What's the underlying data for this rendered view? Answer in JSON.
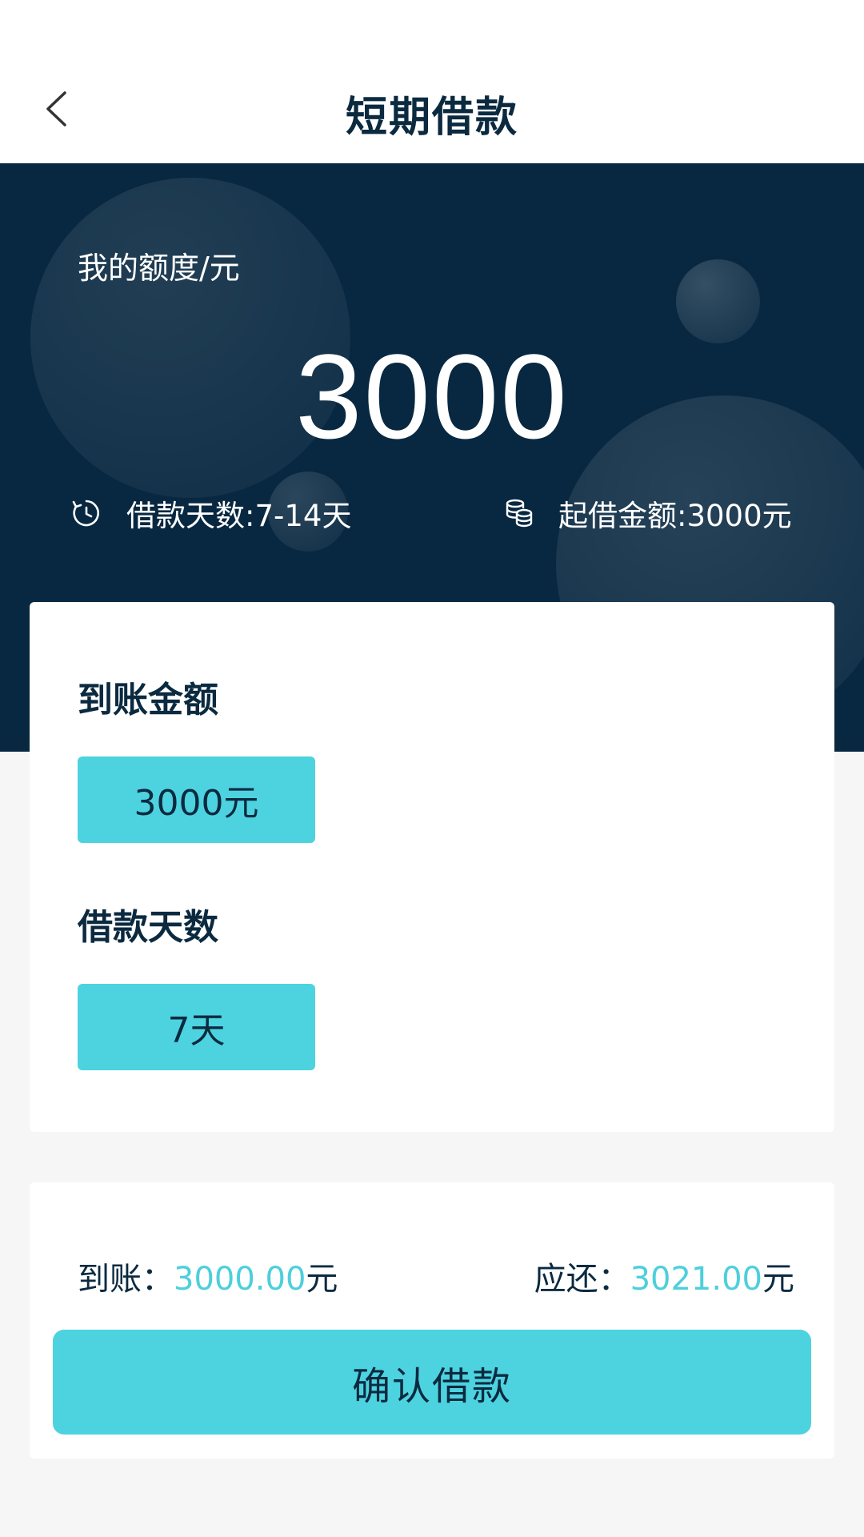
{
  "header": {
    "title": "短期借款",
    "back_icon": "chevron-left-icon"
  },
  "hero": {
    "quota_label": "我的额度/元",
    "quota_amount": "3000",
    "loan_days_text": "借款天数:7-14天",
    "min_amount_text": "起借金额:3000元",
    "loan_days_icon": "clock-refresh-icon",
    "min_amount_icon": "coin-stack-icon"
  },
  "selection": {
    "amount_title": "到账金额",
    "amount_option": "3000元",
    "days_title": "借款天数",
    "days_option": "7天"
  },
  "summary": {
    "arrival_label": "到账：",
    "arrival_value": "3000.00",
    "arrival_unit": "元",
    "repay_label": "应还：",
    "repay_value": "3021.00",
    "repay_unit": "元"
  },
  "confirm_label": "确认借款",
  "colors": {
    "hero_bg": "#082841",
    "accent": "#4dd3df",
    "text_dark": "#0b2a40",
    "page_bg": "#f6f6f6"
  }
}
